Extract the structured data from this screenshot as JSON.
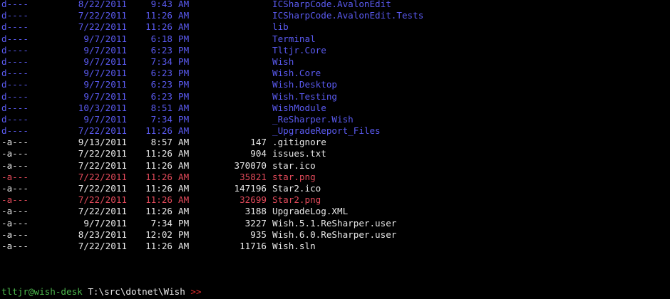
{
  "colors": {
    "background": "#000000",
    "directory": "#5a5af0",
    "file": "#e8e8e8",
    "highlight": "#e24a5a",
    "prompt_user": "#4cb84c",
    "prompt_arrow": "#e02c2c"
  },
  "entries": [
    {
      "kind": "dir",
      "mode": "d----",
      "date": "8/22/2011",
      "time": "9:43",
      "ampm": "AM",
      "length": "",
      "name": "ICSharpCode.AvalonEdit"
    },
    {
      "kind": "dir",
      "mode": "d----",
      "date": "7/22/2011",
      "time": "11:26",
      "ampm": "AM",
      "length": "",
      "name": "ICSharpCode.AvalonEdit.Tests"
    },
    {
      "kind": "dir",
      "mode": "d----",
      "date": "7/22/2011",
      "time": "11:26",
      "ampm": "AM",
      "length": "",
      "name": "lib"
    },
    {
      "kind": "dir",
      "mode": "d----",
      "date": "9/7/2011",
      "time": "6:18",
      "ampm": "PM",
      "length": "",
      "name": "Terminal"
    },
    {
      "kind": "dir",
      "mode": "d----",
      "date": "9/7/2011",
      "time": "6:23",
      "ampm": "PM",
      "length": "",
      "name": "Tltjr.Core"
    },
    {
      "kind": "dir",
      "mode": "d----",
      "date": "9/7/2011",
      "time": "7:34",
      "ampm": "PM",
      "length": "",
      "name": "Wish"
    },
    {
      "kind": "dir",
      "mode": "d----",
      "date": "9/7/2011",
      "time": "6:23",
      "ampm": "PM",
      "length": "",
      "name": "Wish.Core"
    },
    {
      "kind": "dir",
      "mode": "d----",
      "date": "9/7/2011",
      "time": "6:23",
      "ampm": "PM",
      "length": "",
      "name": "Wish.Desktop"
    },
    {
      "kind": "dir",
      "mode": "d----",
      "date": "9/7/2011",
      "time": "6:23",
      "ampm": "PM",
      "length": "",
      "name": "Wish.Testing"
    },
    {
      "kind": "dir",
      "mode": "d----",
      "date": "10/3/2011",
      "time": "8:51",
      "ampm": "AM",
      "length": "",
      "name": "WishModule"
    },
    {
      "kind": "dir",
      "mode": "d----",
      "date": "9/7/2011",
      "time": "7:34",
      "ampm": "PM",
      "length": "",
      "name": "_ReSharper.Wish"
    },
    {
      "kind": "dir",
      "mode": "d----",
      "date": "7/22/2011",
      "time": "11:26",
      "ampm": "AM",
      "length": "",
      "name": "_UpgradeReport_Files"
    },
    {
      "kind": "file",
      "mode": "-a---",
      "date": "9/13/2011",
      "time": "8:57",
      "ampm": "AM",
      "length": "147",
      "name": ".gitignore"
    },
    {
      "kind": "file",
      "mode": "-a---",
      "date": "7/22/2011",
      "time": "11:26",
      "ampm": "AM",
      "length": "904",
      "name": "issues.txt"
    },
    {
      "kind": "file",
      "mode": "-a---",
      "date": "7/22/2011",
      "time": "11:26",
      "ampm": "AM",
      "length": "370070",
      "name": "star.ico"
    },
    {
      "kind": "hl",
      "mode": "-a---",
      "date": "7/22/2011",
      "time": "11:26",
      "ampm": "AM",
      "length": "35821",
      "name": "star.png"
    },
    {
      "kind": "file",
      "mode": "-a---",
      "date": "7/22/2011",
      "time": "11:26",
      "ampm": "AM",
      "length": "147196",
      "name": "Star2.ico"
    },
    {
      "kind": "hl",
      "mode": "-a---",
      "date": "7/22/2011",
      "time": "11:26",
      "ampm": "AM",
      "length": "32699",
      "name": "Star2.png"
    },
    {
      "kind": "file",
      "mode": "-a---",
      "date": "7/22/2011",
      "time": "11:26",
      "ampm": "AM",
      "length": "3188",
      "name": "UpgradeLog.XML"
    },
    {
      "kind": "file",
      "mode": "-a---",
      "date": "9/7/2011",
      "time": "7:34",
      "ampm": "PM",
      "length": "3227",
      "name": "Wish.5.1.ReSharper.user"
    },
    {
      "kind": "file",
      "mode": "-a---",
      "date": "8/23/2011",
      "time": "12:02",
      "ampm": "PM",
      "length": "935",
      "name": "Wish.6.0.ReSharper.user"
    },
    {
      "kind": "file",
      "mode": "-a---",
      "date": "7/22/2011",
      "time": "11:26",
      "ampm": "AM",
      "length": "11716",
      "name": "Wish.sln"
    }
  ],
  "prompt": {
    "user_host": "tltjr@wish-desk",
    "path": "T:\\src\\dotnet\\Wish",
    "arrow": ">>"
  }
}
